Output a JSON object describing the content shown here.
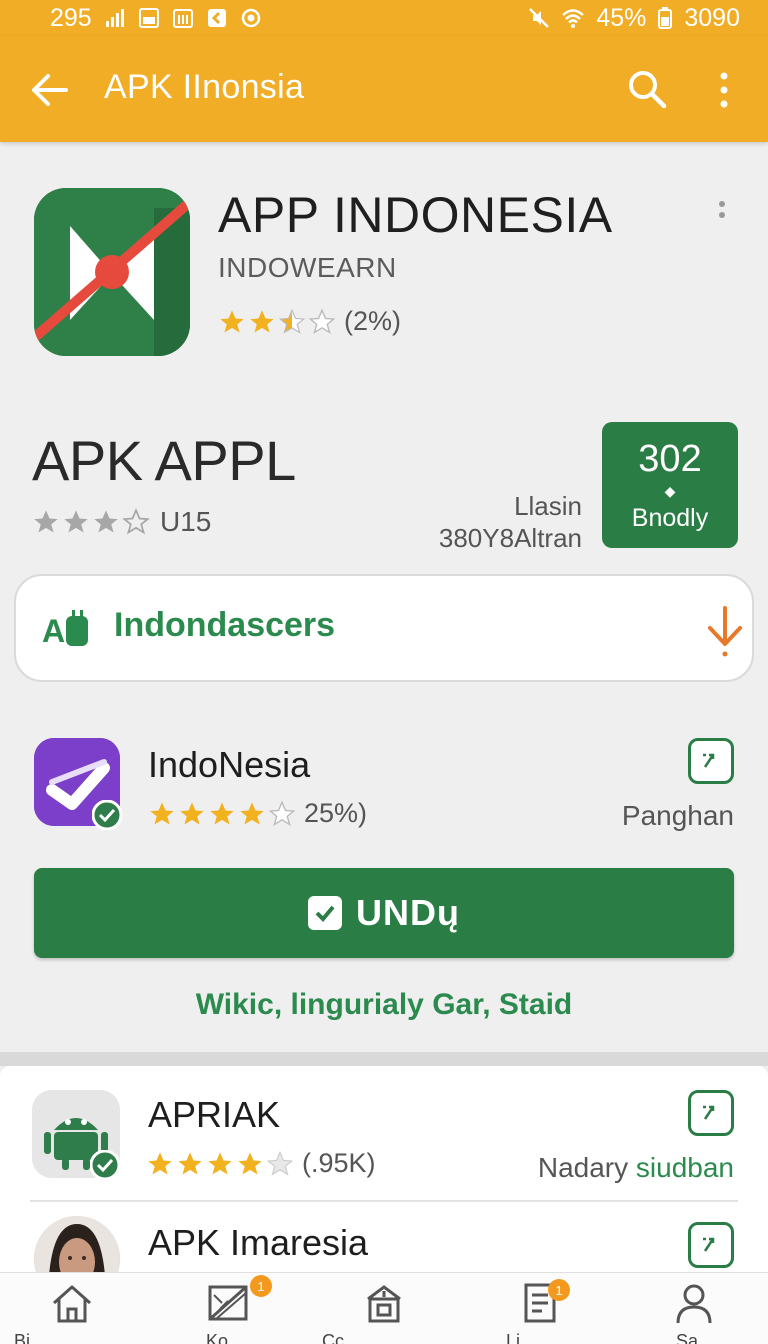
{
  "status_bar": {
    "time": "295",
    "battery": "45%",
    "right_text": "3090",
    "icons": [
      "signal-icon",
      "notification-icon",
      "calendar-icon",
      "message-icon",
      "sync-icon",
      "mute-icon",
      "wifi-icon",
      "battery-icon"
    ]
  },
  "app_bar": {
    "title": "APK IInonsia",
    "icons": [
      "back-arrow-icon",
      "search-icon",
      "more-vert-icon"
    ]
  },
  "featured_app": {
    "name": "APP INDONESIA",
    "developer": "INDOWEARN",
    "rating_stars": 2.5,
    "rating_text": "(2%)"
  },
  "apk_appl": {
    "title": "APK APPL",
    "rating_stars": 3,
    "rating_text": "U15",
    "info_line1": "Llasin",
    "info_line2": "380Y8Altran",
    "box_number": "302",
    "box_label": "Bnodly"
  },
  "search_pill": {
    "text": "Indondascers",
    "icons": [
      "android-logo-icon",
      "download-icon"
    ]
  },
  "indonesia_row": {
    "name": "IndoNesia",
    "rating_stars": 4,
    "rating_text": "25%)",
    "side_text": "Panghan"
  },
  "unduh_button": {
    "label": "UNDų"
  },
  "wiki_text": "Wikic, lingurialy Gar, Staid",
  "list": [
    {
      "name": "APRIAK",
      "rating_stars": 4,
      "rating_text": "(.95K)",
      "side_text_a": "Nadary",
      "side_text_b": "siudban"
    },
    {
      "name": "APK Imaresia"
    }
  ],
  "bottom_nav": [
    {
      "label": "Bi",
      "icon": "home-icon"
    },
    {
      "label": "Ko",
      "icon": "image-icon",
      "badge": "1"
    },
    {
      "label": "Cc",
      "icon": "store-icon"
    },
    {
      "label": "Li",
      "icon": "document-icon",
      "badge": "1"
    },
    {
      "label": "Sa",
      "icon": "profile-icon"
    }
  ],
  "colors": {
    "accent_orange": "#f0ad25",
    "primary_green": "#2a7d44",
    "link_green": "#2b8a4d",
    "star_gold": "#f2b11f",
    "star_gray": "#a7a7a7"
  }
}
